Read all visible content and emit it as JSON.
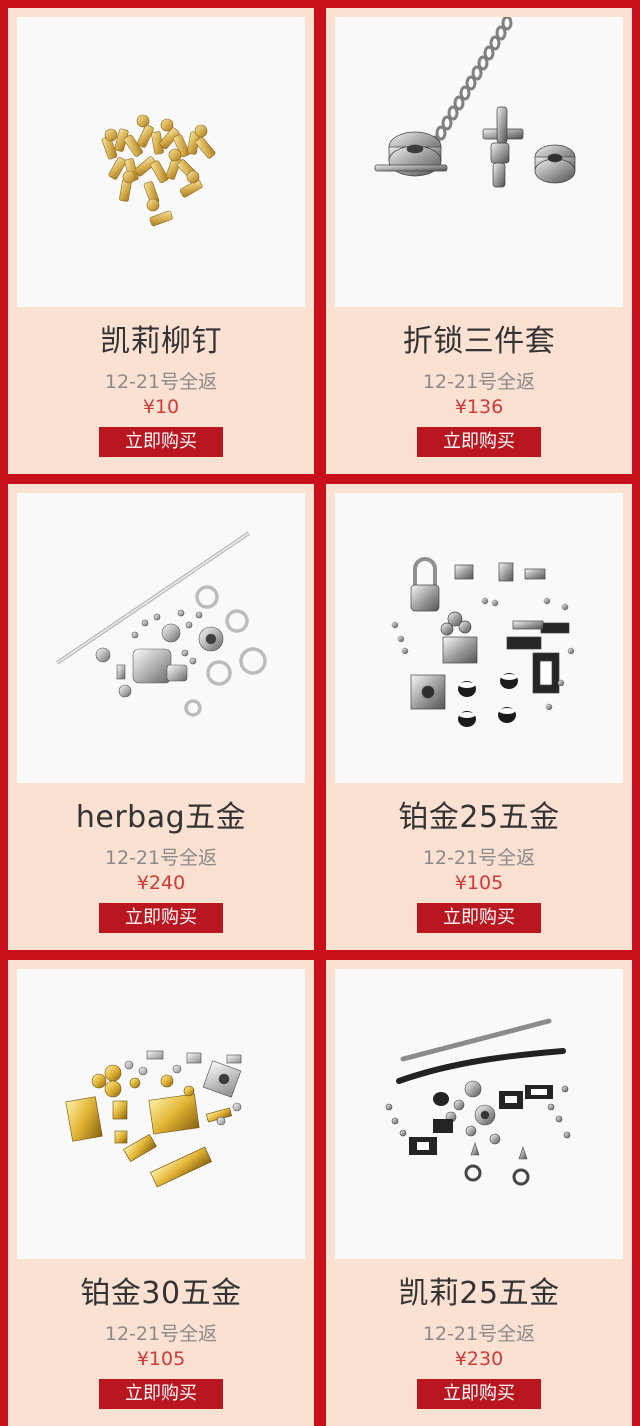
{
  "products": [
    {
      "title": "凯莉柳钉",
      "promo": "12-21号全返",
      "price": "¥10",
      "button": "立即购买",
      "image": "gold-rivets"
    },
    {
      "title": "折锁三件套",
      "promo": "12-21号全返",
      "price": "¥136",
      "button": "立即购买",
      "image": "chain-lock-set"
    },
    {
      "title": "herbag五金",
      "promo": "12-21号全返",
      "price": "¥240",
      "button": "立即购买",
      "image": "silver-hardware-rod"
    },
    {
      "title": "铂金25五金",
      "promo": "12-21号全返",
      "price": "¥105",
      "button": "立即购买",
      "image": "silver-lock-hardware"
    },
    {
      "title": "铂金30五金",
      "promo": "12-21号全返",
      "price": "¥105",
      "button": "立即购买",
      "image": "gold-lock-hardware"
    },
    {
      "title": "凯莉25五金",
      "promo": "12-21号全返",
      "price": "¥230",
      "button": "立即购买",
      "image": "black-strap-hardware"
    }
  ],
  "colors": {
    "page_background": "#c8101a",
    "card_background": "#fbe1d2",
    "button": "#b91620",
    "price": "#d23a3a"
  }
}
